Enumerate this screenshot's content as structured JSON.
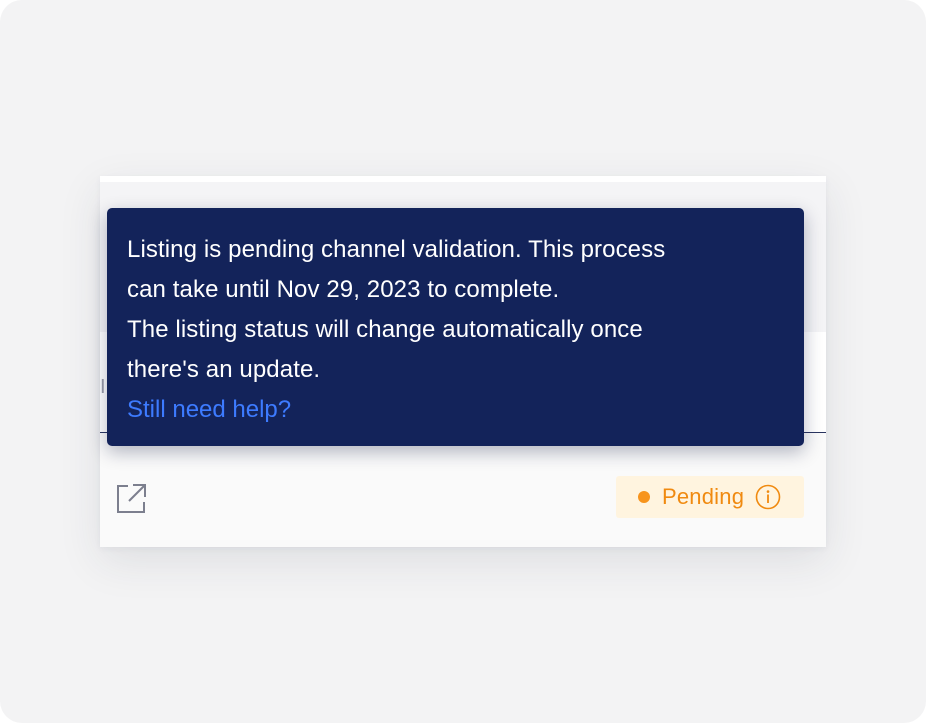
{
  "card": {
    "middle_fragment": "I"
  },
  "status": {
    "label": "Pending",
    "dot_color": "#f7941d",
    "text_color": "#f08a10",
    "background": "#fff4df"
  },
  "tooltip": {
    "line1": "Listing is pending channel validation. This process",
    "line2": "can take until Nov 29, 2023 to complete.",
    "line3": "The listing status will change automatically once",
    "line4": "there's an update.",
    "link_label": "Still need help?",
    "background": "#13235a",
    "link_color": "#3d7bff"
  },
  "icons": {
    "open_external": "open-external-icon",
    "info": "info-icon"
  }
}
